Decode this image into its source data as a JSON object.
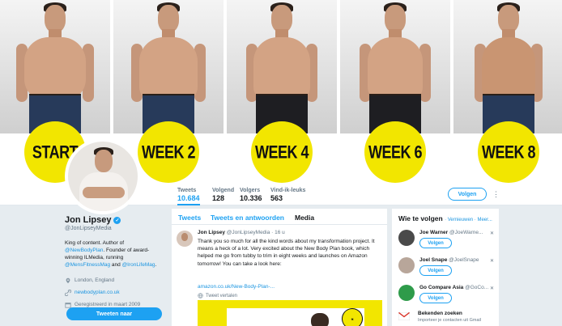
{
  "banner": {
    "labels": [
      "START",
      "WEEK 2",
      "WEEK 4",
      "WEEK 6",
      "WEEK 8"
    ],
    "accent_color": "#f2e600"
  },
  "profile": {
    "name": "Jon Lipsey",
    "handle": "@JonLipseyMedia",
    "bio_pre": "King of content. Author of",
    "bio_link1": "@NewBodyPlan",
    "bio_mid": ". Founder of award-winning ILMedia, running",
    "bio_link2": "@MensFitnessMag",
    "bio_and": "and",
    "bio_link3": "@IronLifeMag",
    "bio_end": ".",
    "location": "London, England",
    "website": "newbodyplan.co.uk",
    "joined": "Geregistreerd in maart 2009",
    "tweet_button": "Tweeten naar"
  },
  "stats": [
    {
      "label": "Tweets",
      "value": "10.684"
    },
    {
      "label": "Volgend",
      "value": "128"
    },
    {
      "label": "Volgers",
      "value": "10.336"
    },
    {
      "label": "Vind-ik-leuks",
      "value": "563"
    }
  ],
  "follow_button": "Volgen",
  "timeline": {
    "tabs": [
      "Tweets",
      "Tweets en antwoorden",
      "Media"
    ],
    "tweet": {
      "name": "Jon Lipsey",
      "handle": "@JonLipseyMedia",
      "time": "· 16 u",
      "text": "Thank you so much for all the kind words about my transformation project. It means a heck of a lot. Very excited about the New Body Plan book, which helped me go from tubby to trim in eight weeks and launches on Amazon tomorrow! You can take a look here:",
      "link": "amazon.co.uk/New-Body-Plan-...",
      "translate": "Tweet vertalen"
    }
  },
  "who_to_follow": {
    "title": "Wie te volgen",
    "refresh": "· Vernieuwen · Meer...",
    "suggestions": [
      {
        "name": "Joe Warner",
        "handle": "@JoeWarne...",
        "button": "Volgen"
      },
      {
        "name": "Joel Snape",
        "handle": "@JoelSnape",
        "button": "Volgen"
      },
      {
        "name": "Go Compare Asia",
        "handle": "@GoCo...",
        "button": "Volgen"
      }
    ],
    "friends_title": "Bekenden zoeken",
    "friends_sub": "Importeer je contacten uit Gmail"
  }
}
